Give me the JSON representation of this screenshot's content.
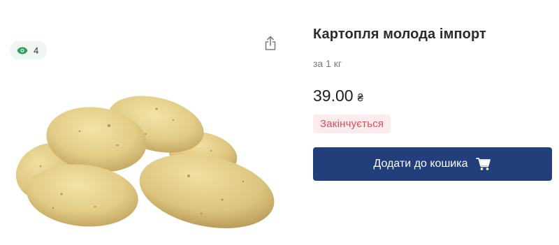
{
  "gallery": {
    "views_count": "4",
    "eye_icon": "eye-icon",
    "share_icon": "share-icon"
  },
  "product": {
    "title": "Картопля молода імпорт",
    "unit": "за 1 кг",
    "price": "39.00",
    "currency": "₴",
    "stock_status": "Закінчується",
    "add_to_cart_label": "Додати до кошика",
    "cart_icon": "cart-icon"
  },
  "colors": {
    "accent": "#223f7c",
    "eye": "#2e9e5b",
    "stock_text": "#e24a5c",
    "stock_bg": "#fdecee"
  }
}
